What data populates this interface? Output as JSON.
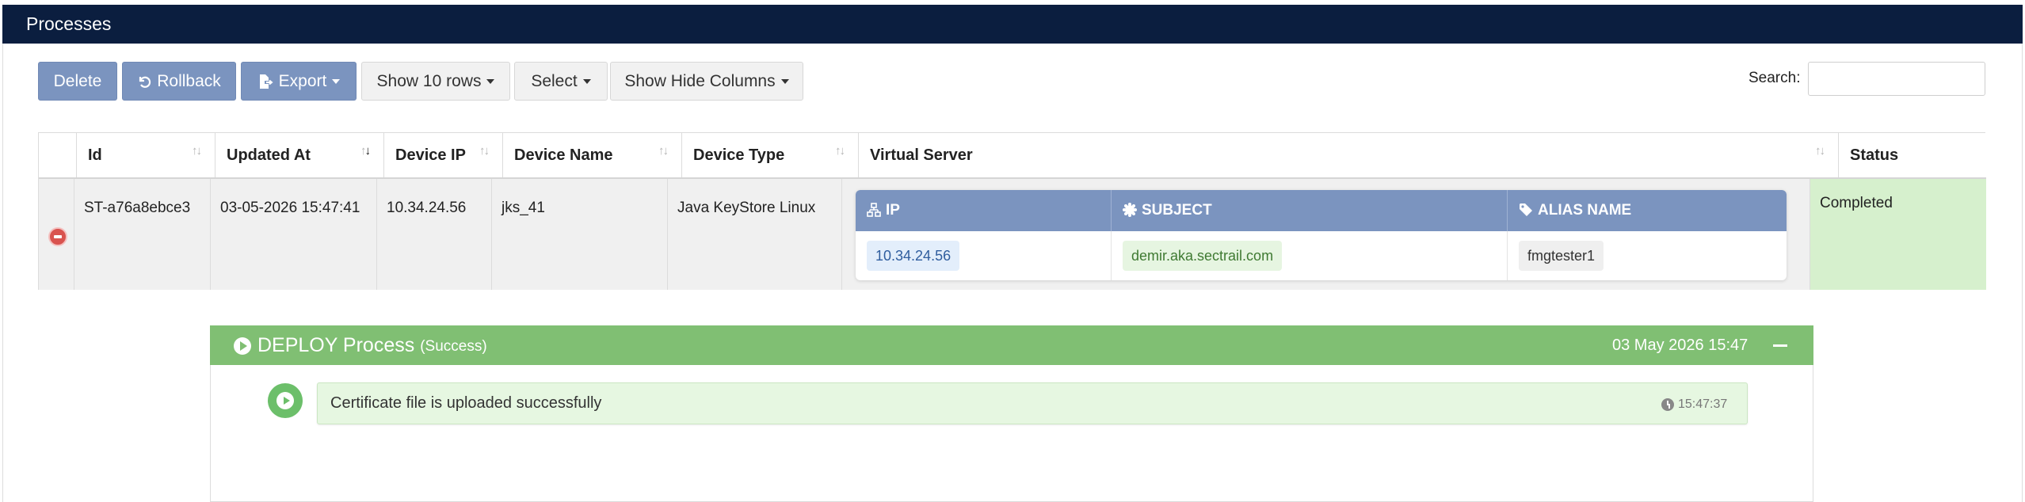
{
  "header": {
    "title": "Processes"
  },
  "toolbar": {
    "delete_label": "Delete",
    "rollback_label": "Rollback",
    "export_label": "Export",
    "show_rows_label": "Show 10 rows",
    "select_label": "Select",
    "columns_label": "Show Hide Columns"
  },
  "search": {
    "label": "Search:",
    "value": "",
    "placeholder": ""
  },
  "table": {
    "columns": [
      "Id",
      "Updated At",
      "Device IP",
      "Device Name",
      "Device Type",
      "Virtual Server",
      "Status"
    ],
    "sort_icons": [
      "sort-icon",
      "sort-desc-icon"
    ],
    "rows": [
      {
        "id": "ST-a76a8ebce3",
        "updated_at": "03-05-2026 15:47:41",
        "device_ip": "10.34.24.56",
        "device_name": "jks_41",
        "device_type": "Java KeyStore Linux",
        "status": "Completed",
        "virtual_server": {
          "columns": [
            "IP",
            "SUBJECT",
            "ALIAS NAME"
          ],
          "ip": "10.34.24.56",
          "subject": "demir.aka.sectrail.com",
          "alias": "fmgtester1"
        }
      }
    ]
  },
  "process": {
    "title": "DEPLOY Process",
    "result": "(Success)",
    "date": "03 May 2026 15:47",
    "steps": [
      {
        "text": "Certificate file is uploaded successfully",
        "time": "15:47:37"
      }
    ]
  },
  "colors": {
    "header_bg": "#0b1e3f",
    "primary_button": "#7b94bf",
    "success_green": "#80bf73",
    "status_bg": "#d6f0cd",
    "danger": "#d9534f"
  }
}
